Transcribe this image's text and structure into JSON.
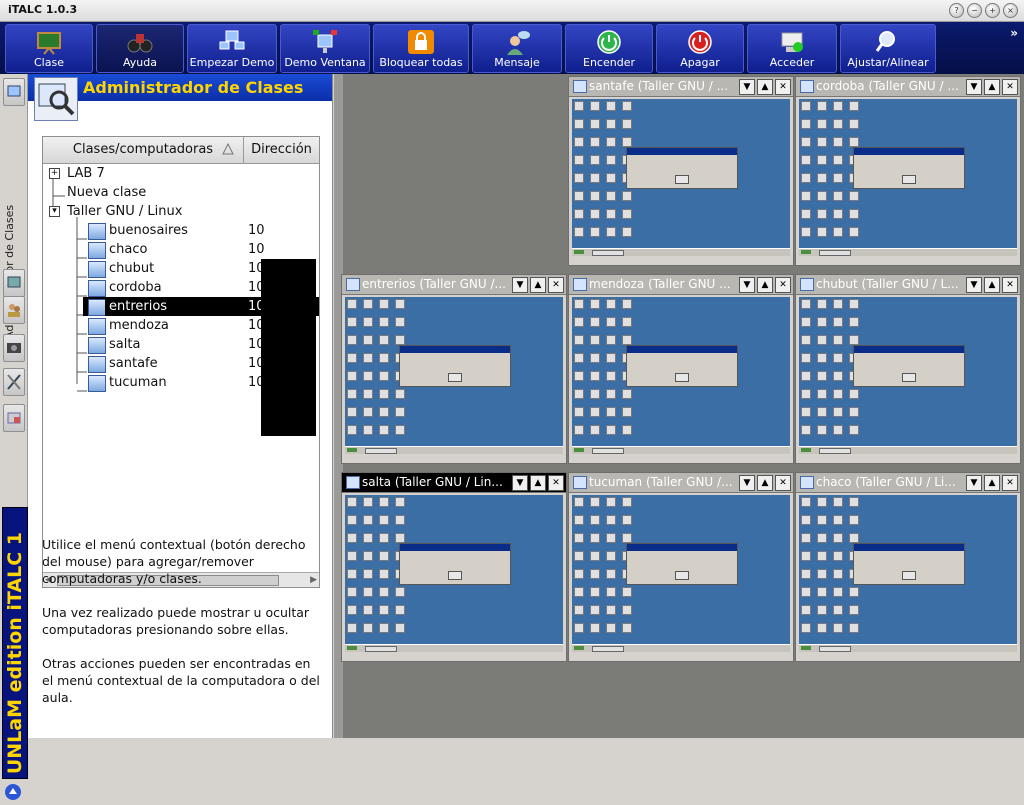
{
  "window": {
    "title": "iTALC 1.0.3"
  },
  "toolbar": {
    "buttons": [
      {
        "label": "Clase",
        "icon": "classroom-board-icon"
      },
      {
        "label": "Ayuda",
        "icon": "binoculars-icon"
      },
      {
        "label": "Empezar Demo",
        "icon": "demo-monitors-icon"
      },
      {
        "label": "Demo Ventana",
        "icon": "demo-window-icon"
      },
      {
        "label": "Bloquear todas",
        "icon": "lock-icon"
      },
      {
        "label": "Mensaje",
        "icon": "message-icon"
      },
      {
        "label": "Encender",
        "icon": "power-on-icon"
      },
      {
        "label": "Apagar",
        "icon": "power-off-icon"
      },
      {
        "label": "Acceder",
        "icon": "login-icon"
      },
      {
        "label": "Ajustar/Alinear",
        "icon": "magnifier-icon"
      }
    ],
    "more": "»"
  },
  "sidebar": {
    "vertical_label": "Administrador de Clases",
    "brand": "UNLaM edition iTALC 1"
  },
  "panel": {
    "title": "Administrador de Clases",
    "columns": [
      "Clases/computadoras",
      "Dirección"
    ],
    "tree": [
      {
        "label": "LAB 7",
        "type": "class",
        "expanded": false
      },
      {
        "label": "Nueva clase",
        "type": "class",
        "expanded": null
      },
      {
        "label": "Taller GNU / Linux",
        "type": "class",
        "expanded": true
      },
      {
        "label": "buenosaires",
        "type": "computer",
        "ip": "10"
      },
      {
        "label": "chaco",
        "type": "computer",
        "ip": "10"
      },
      {
        "label": "chubut",
        "type": "computer",
        "ip": "10"
      },
      {
        "label": "cordoba",
        "type": "computer",
        "ip": "10"
      },
      {
        "label": "entrerios",
        "type": "computer",
        "ip": "10",
        "selected": true
      },
      {
        "label": "mendoza",
        "type": "computer",
        "ip": "10"
      },
      {
        "label": "salta",
        "type": "computer",
        "ip": "10"
      },
      {
        "label": "santafe",
        "type": "computer",
        "ip": "10"
      },
      {
        "label": "tucuman",
        "type": "computer",
        "ip": "10"
      }
    ],
    "help": [
      "Utilice el menú contextual (botón derecho del mouse) para agregar/remover computadoras y/o clases.",
      "Una vez realizado puede mostrar u ocultar computadoras  presionando sobre ellas.",
      "Otras acciones pueden ser encontradas en el menú contextual de la computadora o del aula."
    ]
  },
  "monitors": [
    {
      "title": "santafe  (Taller GNU / ..."
    },
    {
      "title": "cordoba (Taller GNU / ..."
    },
    {
      "title": "entrerios (Taller GNU /..."
    },
    {
      "title": "mendoza (Taller GNU ..."
    },
    {
      "title": "chubut (Taller GNU / L..."
    },
    {
      "title": "salta (Taller GNU / Lin...",
      "active": true
    },
    {
      "title": "tucuman (Taller GNU /..."
    },
    {
      "title": "chaco (Taller GNU / Li..."
    }
  ]
}
